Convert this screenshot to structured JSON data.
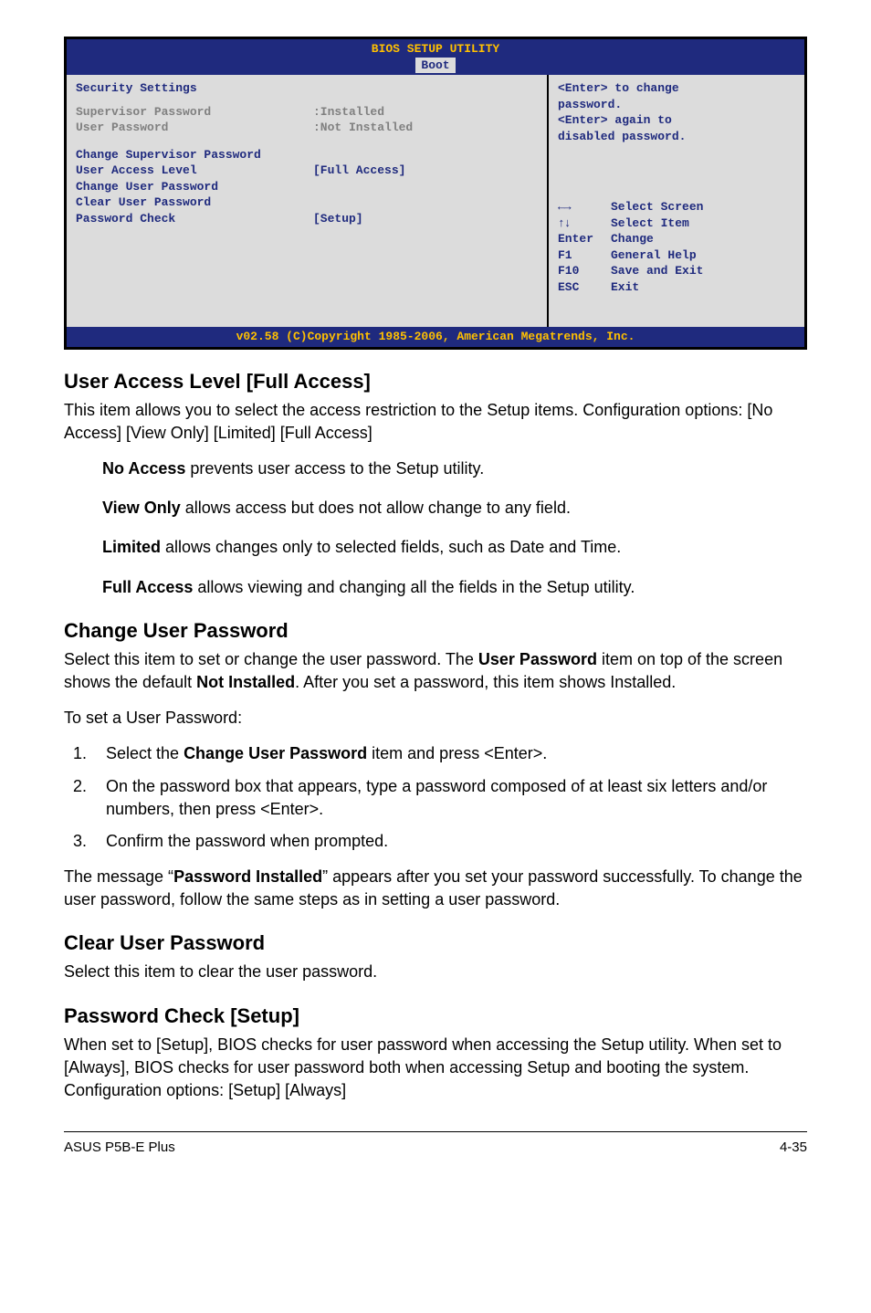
{
  "bios": {
    "title": "BIOS SETUP UTILITY",
    "tab": "Boot",
    "heading": "Security Settings",
    "lines": {
      "supPwdLabel": "Supervisor Password",
      "supPwdVal": ":Installed",
      "usrPwdLabel": "User Password",
      "usrPwdVal": ":Not Installed",
      "chgSup": "Change Supervisor Password",
      "ualLabel": "User Access Level",
      "ualVal": "[Full Access]",
      "chgUsr": "Change User Password",
      "clrUsr": "Clear User Password",
      "pcLabel": "Password Check",
      "pcVal": "[Setup]"
    },
    "help": {
      "l1": "<Enter> to change",
      "l2": "password.",
      "l3": "<Enter> again to",
      "l4": "disabled password."
    },
    "keys": {
      "selScreen": "Select Screen",
      "selItem": "Select Item",
      "enterK": "Enter",
      "enterD": "Change",
      "f1K": "F1",
      "f1D": "General Help",
      "f10K": "F10",
      "f10D": "Save and Exit",
      "escK": "ESC",
      "escD": "Exit"
    },
    "footer": "v02.58 (C)Copyright 1985-2006, American Megatrends, Inc."
  },
  "doc": {
    "h_ual": "User Access Level [Full Access]",
    "p_ual1": "This item allows you to select the access restriction to the Setup items. Configuration options: [No Access] [View Only] [Limited] [Full Access]",
    "ual_na_b": "No Access",
    "ual_na_t": " prevents user access to the Setup utility.",
    "ual_vo_b": "View Only",
    "ual_vo_t": " allows access but does not allow change to any field.",
    "ual_li_b": "Limited",
    "ual_li_t": " allows changes only to selected fields, such as Date and Time.",
    "ual_fa_b": "Full Access",
    "ual_fa_t": " allows viewing and changing all the fields in the Setup utility.",
    "h_cup": "Change User Password",
    "p_cup1_a": "Select this item to set or change the user password. The ",
    "p_cup1_b1": "User Password",
    "p_cup1_c": " item on top of the screen shows the default ",
    "p_cup1_b2": "Not Installed",
    "p_cup1_d": ". After you set a password, this item shows Installed.",
    "p_setUP": "To set a User Password:",
    "li1_a": "Select the ",
    "li1_b": "Change User Password",
    "li1_c": " item and press <Enter>.",
    "li2": "On the password box that appears, type a password composed of at least six letters and/or numbers, then press <Enter>.",
    "li3": "Confirm the password when prompted.",
    "p_msg_a": "The message “",
    "p_msg_b": "Password Installed",
    "p_msg_c": "” appears after you set your password successfully. To change the user password, follow the same steps as in setting a user password.",
    "h_clr": "Clear User Password",
    "p_clr": "Select this item to clear the user password.",
    "h_pc": "Password Check [Setup]",
    "p_pc": "When set to [Setup], BIOS checks for user password when accessing the Setup utility. When set to [Always], BIOS checks for user password both when accessing Setup and booting the system. Configuration options: [Setup] [Always]",
    "footerLeft": "ASUS P5B-E Plus",
    "footerRight": "4-35"
  }
}
